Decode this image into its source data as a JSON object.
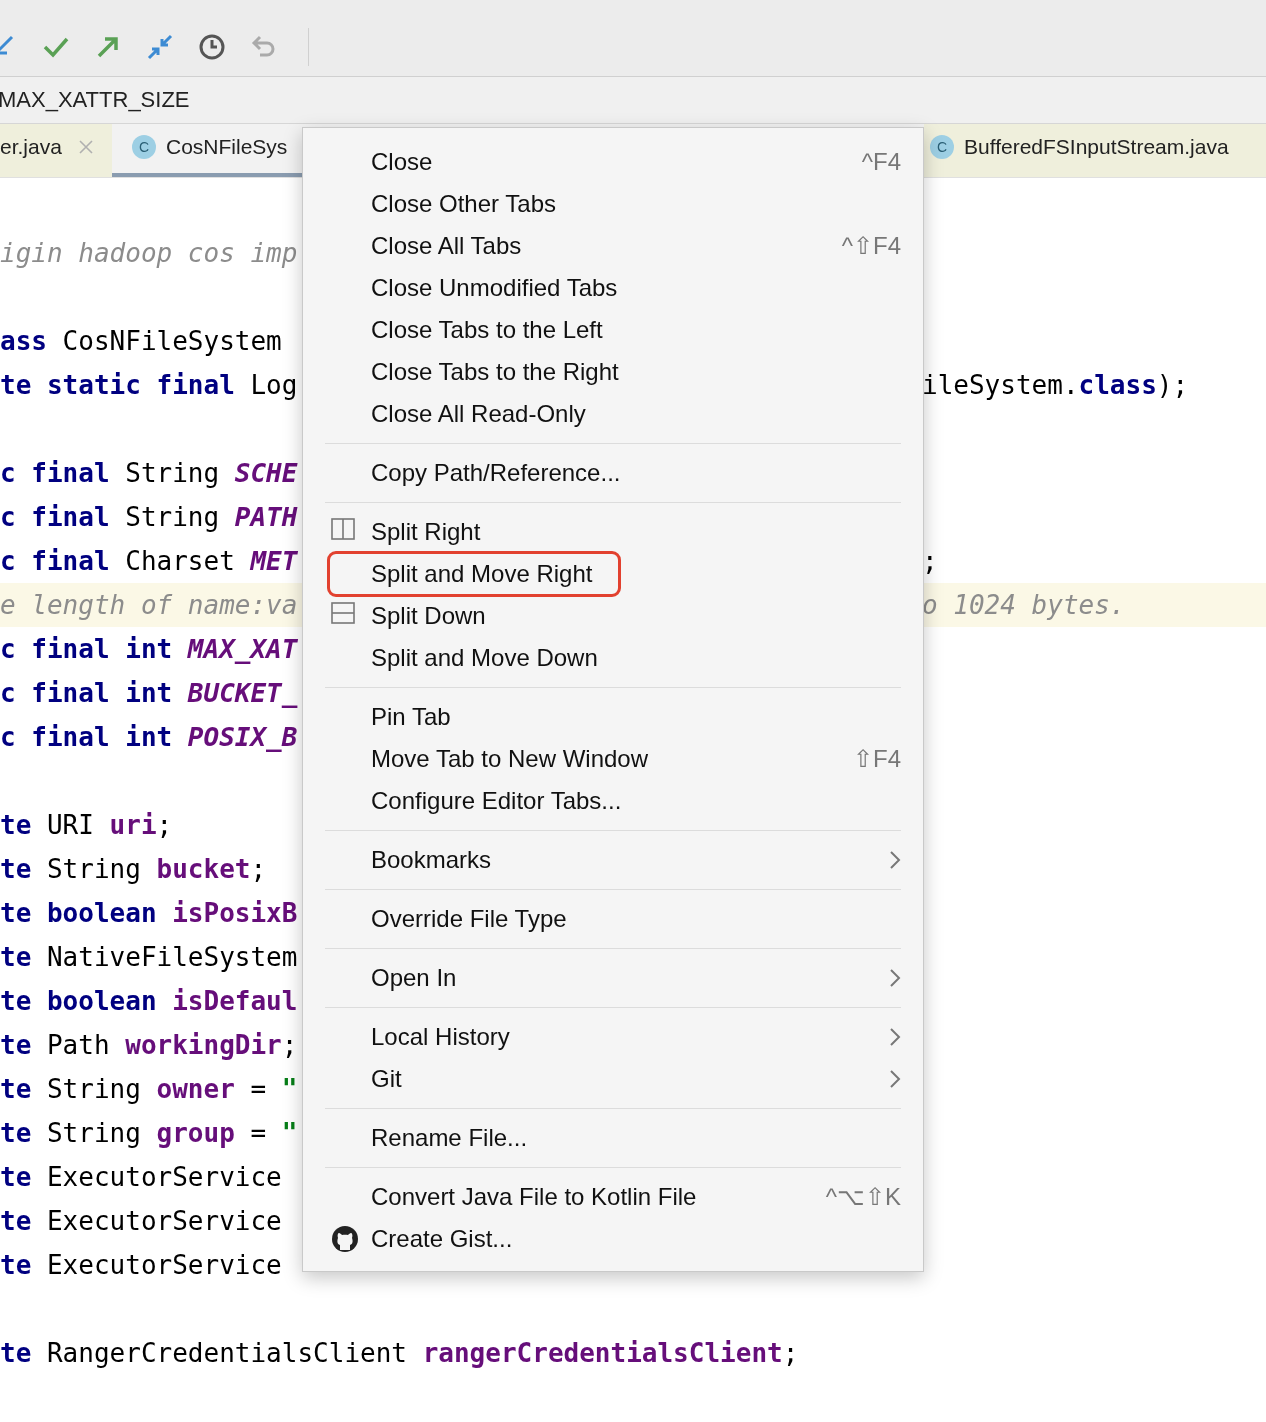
{
  "breadcrumb": "MAX_XATTR_SIZE",
  "tabs_left": [
    {
      "label": "er.java",
      "closable": true,
      "selected": false
    },
    {
      "label": "CosNFileSys",
      "badge": "C",
      "closable": false,
      "selected": true
    }
  ],
  "tabs_right": [
    {
      "label": "BufferedFSInputStream.java",
      "badge": "C",
      "closable": false,
      "selected": false
    }
  ],
  "code_blocks": [
    [
      {
        "highlighted": false,
        "left": [
          {
            "kind": "comment",
            "text": "igin hadoop cos imp"
          }
        ]
      }
    ],
    [
      {
        "highlighted": false,
        "left": [
          {
            "kind": "keyword",
            "text": "ass"
          },
          {
            "kind": "plain",
            "text": " CosNFileSystem"
          }
        ]
      },
      {
        "highlighted": false,
        "left": [
          {
            "kind": "keyword",
            "text": "te static final"
          },
          {
            "kind": "plain",
            "text": " Log"
          }
        ],
        "right": [
          {
            "kind": "plain",
            "text": "ileSystem."
          },
          {
            "kind": "keyword",
            "text": "class"
          },
          {
            "kind": "plain",
            "text": ");"
          }
        ]
      }
    ],
    [
      {
        "highlighted": false,
        "left": [
          {
            "kind": "keyword",
            "text": "c final"
          },
          {
            "kind": "plain",
            "text": " String "
          },
          {
            "kind": "constant",
            "text": "SCHE"
          }
        ]
      },
      {
        "highlighted": false,
        "left": [
          {
            "kind": "keyword",
            "text": "c final"
          },
          {
            "kind": "plain",
            "text": " String "
          },
          {
            "kind": "constant",
            "text": "PATH"
          }
        ]
      },
      {
        "highlighted": false,
        "left": [
          {
            "kind": "keyword",
            "text": "c final"
          },
          {
            "kind": "plain",
            "text": " Charset "
          },
          {
            "kind": "constant",
            "text": "MET"
          }
        ],
        "right": [
          {
            "kind": "plain",
            "text": ";"
          }
        ]
      },
      {
        "highlighted": true,
        "left": [
          {
            "kind": "comment",
            "text": "e length of name:va"
          }
        ],
        "right": [
          {
            "kind": "comment",
            "text": "o 1024 bytes."
          }
        ]
      },
      {
        "highlighted": false,
        "left": [
          {
            "kind": "keyword",
            "text": "c final int "
          },
          {
            "kind": "constant",
            "text": "MAX_XAT"
          }
        ]
      },
      {
        "highlighted": false,
        "left": [
          {
            "kind": "keyword",
            "text": "c final int "
          },
          {
            "kind": "constant",
            "text": "BUCKET_"
          }
        ]
      },
      {
        "highlighted": false,
        "left": [
          {
            "kind": "keyword",
            "text": "c final int "
          },
          {
            "kind": "constant",
            "text": "POSIX_B"
          }
        ]
      }
    ],
    [
      {
        "highlighted": false,
        "left": [
          {
            "kind": "keyword",
            "text": "te"
          },
          {
            "kind": "plain",
            "text": " URI "
          },
          {
            "kind": "field",
            "text": "uri"
          },
          {
            "kind": "plain",
            "text": ";"
          }
        ]
      },
      {
        "highlighted": false,
        "left": [
          {
            "kind": "keyword",
            "text": "te"
          },
          {
            "kind": "plain",
            "text": " String "
          },
          {
            "kind": "field",
            "text": "bucket"
          },
          {
            "kind": "plain",
            "text": ";"
          }
        ]
      },
      {
        "highlighted": false,
        "left": [
          {
            "kind": "keyword",
            "text": "te boolean "
          },
          {
            "kind": "field",
            "text": "isPosixB"
          }
        ]
      },
      {
        "highlighted": false,
        "left": [
          {
            "kind": "keyword",
            "text": "te"
          },
          {
            "kind": "plain",
            "text": " NativeFileSystem"
          }
        ]
      },
      {
        "highlighted": false,
        "left": [
          {
            "kind": "keyword",
            "text": "te boolean "
          },
          {
            "kind": "field",
            "text": "isDefaul"
          }
        ]
      },
      {
        "highlighted": false,
        "left": [
          {
            "kind": "keyword",
            "text": "te"
          },
          {
            "kind": "plain",
            "text": " Path "
          },
          {
            "kind": "field",
            "text": "workingDir"
          },
          {
            "kind": "plain",
            "text": ";"
          }
        ]
      },
      {
        "highlighted": false,
        "left": [
          {
            "kind": "keyword",
            "text": "te"
          },
          {
            "kind": "plain",
            "text": " String "
          },
          {
            "kind": "field",
            "text": "owner"
          },
          {
            "kind": "plain",
            "text": " = "
          },
          {
            "kind": "string",
            "text": "\""
          }
        ]
      },
      {
        "highlighted": false,
        "left": [
          {
            "kind": "keyword",
            "text": "te"
          },
          {
            "kind": "plain",
            "text": " String "
          },
          {
            "kind": "field",
            "text": "group"
          },
          {
            "kind": "plain",
            "text": " = "
          },
          {
            "kind": "string",
            "text": "\""
          }
        ]
      },
      {
        "highlighted": false,
        "left": [
          {
            "kind": "keyword",
            "text": "te"
          },
          {
            "kind": "plain",
            "text": " ExecutorService"
          }
        ]
      },
      {
        "highlighted": false,
        "left": [
          {
            "kind": "keyword",
            "text": "te"
          },
          {
            "kind": "plain",
            "text": " ExecutorService"
          }
        ]
      },
      {
        "highlighted": false,
        "left": [
          {
            "kind": "keyword",
            "text": "te"
          },
          {
            "kind": "plain",
            "text": " ExecutorService"
          }
        ]
      }
    ],
    [
      {
        "highlighted": false,
        "left": [
          {
            "kind": "keyword",
            "text": "te"
          },
          {
            "kind": "plain",
            "text": " RangerCredentialsClient "
          },
          {
            "kind": "field",
            "text": "rangerCredentialsClient"
          },
          {
            "kind": "plain",
            "text": ";"
          }
        ]
      }
    ]
  ],
  "context_menu": {
    "sections": [
      [
        {
          "label": "Close",
          "shortcut": "^F4",
          "submenu": false,
          "outlined": false
        },
        {
          "label": "Close Other Tabs",
          "submenu": false,
          "outlined": false
        },
        {
          "label": "Close All Tabs",
          "shortcut": "^⇧F4",
          "submenu": false,
          "outlined": false
        },
        {
          "label": "Close Unmodified Tabs",
          "submenu": false,
          "outlined": false
        },
        {
          "label": "Close Tabs to the Left",
          "submenu": false,
          "outlined": false
        },
        {
          "label": "Close Tabs to the Right",
          "submenu": false,
          "outlined": false
        },
        {
          "label": "Close All Read-Only",
          "submenu": false,
          "outlined": false
        }
      ],
      [
        {
          "label": "Copy Path/Reference...",
          "submenu": false,
          "outlined": false
        }
      ],
      [
        {
          "label": "Split Right",
          "submenu": false,
          "outlined": false
        },
        {
          "label": "Split and Move Right",
          "submenu": false,
          "outlined": true
        },
        {
          "label": "Split Down",
          "submenu": false,
          "outlined": false
        },
        {
          "label": "Split and Move Down",
          "submenu": false,
          "outlined": false
        }
      ],
      [
        {
          "label": "Pin Tab",
          "submenu": false,
          "outlined": false
        },
        {
          "label": "Move Tab to New Window",
          "shortcut": "⇧F4",
          "submenu": false,
          "outlined": false
        },
        {
          "label": "Configure Editor Tabs...",
          "submenu": false,
          "outlined": false
        }
      ],
      [
        {
          "label": "Bookmarks",
          "submenu": true,
          "outlined": false
        }
      ],
      [
        {
          "label": "Override File Type",
          "submenu": false,
          "outlined": false
        }
      ],
      [
        {
          "label": "Open In",
          "submenu": true,
          "outlined": false
        }
      ],
      [
        {
          "label": "Local History",
          "submenu": true,
          "outlined": false
        },
        {
          "label": "Git",
          "submenu": true,
          "outlined": false
        }
      ],
      [
        {
          "label": "Rename File...",
          "submenu": false,
          "outlined": false
        }
      ],
      [
        {
          "label": "Convert Java File to Kotlin File",
          "shortcut": "^⌥⇧K",
          "submenu": false,
          "outlined": false
        },
        {
          "label": "Create Gist...",
          "submenu": false,
          "outlined": false
        }
      ]
    ]
  }
}
